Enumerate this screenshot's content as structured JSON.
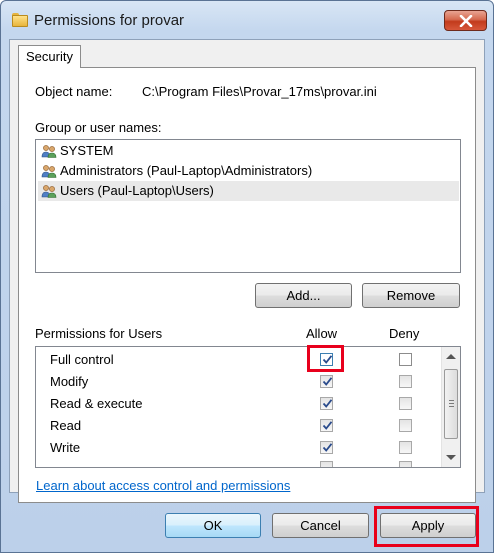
{
  "window": {
    "title": "Permissions for provar"
  },
  "tabs": [
    {
      "label": "Security"
    }
  ],
  "object": {
    "label": "Object name:",
    "value": "C:\\Program Files\\Provar_17ms\\provar.ini"
  },
  "groups": {
    "label": "Group or user names:",
    "items": [
      {
        "label": "SYSTEM",
        "selected": false
      },
      {
        "label": "Administrators (Paul-Laptop\\Administrators)",
        "selected": false
      },
      {
        "label": "Users (Paul-Laptop\\Users)",
        "selected": true
      }
    ],
    "add_label": "Add...",
    "remove_label": "Remove"
  },
  "permissions": {
    "label": "Permissions for Users",
    "allow_header": "Allow",
    "deny_header": "Deny",
    "rows": [
      {
        "label": "Full control",
        "allow": true,
        "deny": false
      },
      {
        "label": "Modify",
        "allow": true,
        "deny": false
      },
      {
        "label": "Read & execute",
        "allow": true,
        "deny": false
      },
      {
        "label": "Read",
        "allow": true,
        "deny": false
      },
      {
        "label": "Write",
        "allow": true,
        "deny": false
      }
    ]
  },
  "link_text": "Learn about access control and permissions",
  "buttons": {
    "ok": "OK",
    "cancel": "Cancel",
    "apply": "Apply"
  },
  "colors": {
    "highlight": "#e8001c",
    "link": "#0066cc",
    "selection": "#e9e9e9"
  }
}
